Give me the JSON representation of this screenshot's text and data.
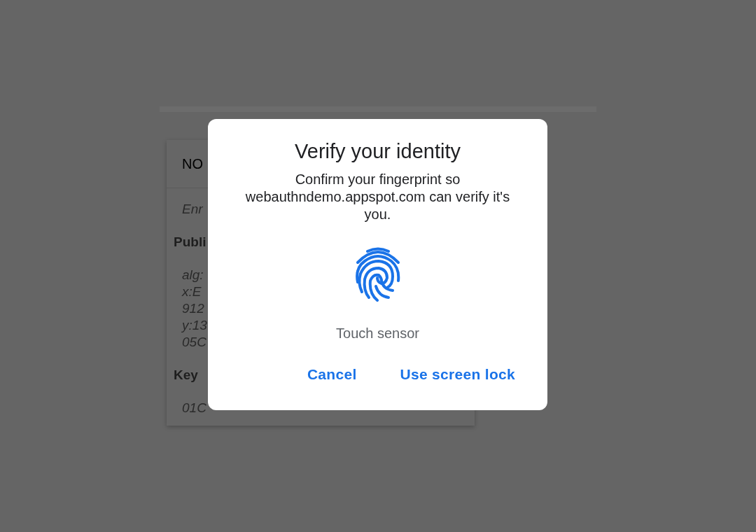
{
  "background_card": {
    "header": "NO",
    "lines": [
      {
        "kind": "note",
        "text": "Enr"
      },
      {
        "kind": "heading",
        "text": "Publi"
      },
      {
        "kind": "value",
        "text": "alg:"
      },
      {
        "kind": "value",
        "text": "x:E"
      },
      {
        "kind": "value",
        "text": "912"
      },
      {
        "kind": "value",
        "text": "y:13"
      },
      {
        "kind": "value",
        "text": "05C"
      },
      {
        "kind": "heading",
        "text": "Key"
      },
      {
        "kind": "value",
        "text": "01C"
      }
    ]
  },
  "dialog": {
    "title": "Verify your identity",
    "message": "Confirm your fingerprint so webauthndemo.appspot.com can verify it's you.",
    "status": "Touch sensor",
    "buttons": [
      "Cancel",
      "Use screen lock"
    ]
  }
}
